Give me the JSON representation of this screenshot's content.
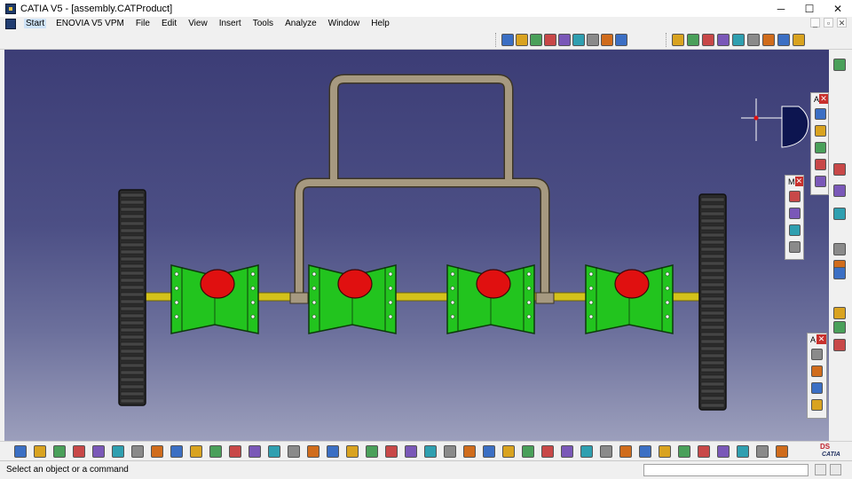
{
  "window": {
    "title": "CATIA V5 - [assembly.CATProduct]",
    "minimize_glyph": "─",
    "maximize_glyph": "☐",
    "close_glyph": "✕"
  },
  "menu": {
    "items": [
      "Start",
      "ENOVIA V5 VPM",
      "File",
      "Edit",
      "View",
      "Insert",
      "Tools",
      "Analyze",
      "Window",
      "Help"
    ],
    "doc_controls": [
      "_",
      "▫",
      "✕"
    ]
  },
  "palettes": {
    "analysis": {
      "title": "A",
      "close": "✕"
    },
    "measure": {
      "title": "M",
      "close": "✕"
    },
    "apply": {
      "title": "A",
      "close": "✕"
    }
  },
  "status": {
    "message": "Select an object or a command"
  },
  "brand": {
    "logo_text": "CATIA",
    "ds_text": "DS"
  },
  "colors": {
    "viewport_top": "#3c3d76",
    "roller_green": "#22c41e",
    "wheel_dark": "#2b2b2b",
    "axle_yellow": "#d4c21a",
    "frame_tan": "#a69980",
    "marker_red": "#e01010"
  },
  "toolbars": {
    "top_icons": [
      "fly-mode-icon",
      "select-icon",
      "analysis-icon",
      "visualization-icon",
      "measure-icon",
      "graph-icon",
      "sketch-icon",
      "rotate-icon",
      "grid-icon",
      "product-icon",
      "structure-icon",
      "component-icon",
      "insert-icon",
      "replace-icon",
      "reorder-icon",
      "catalog-icon",
      "update-icon",
      "publish-icon"
    ],
    "bottom_icons": [
      "grid-icon",
      "new-icon",
      "open-icon",
      "save-icon",
      "print-icon",
      "cut-icon",
      "copy-icon",
      "paste-icon",
      "undo-icon",
      "redo-icon",
      "whatsthis-icon",
      "formula-icon",
      "comment-icon",
      "table-icon",
      "graph-icon",
      "macro-icon",
      "render-icon",
      "fly-icon",
      "fit-all-icon",
      "pan-icon",
      "rotate-icon",
      "zoom-in-icon",
      "zoom-out-icon",
      "normal-view-icon",
      "iso-view-icon",
      "quick-view-icon",
      "multi-view-icon",
      "shading-icon",
      "hide-show-icon",
      "swap-icon",
      "constraint-icon",
      "snap-icon",
      "explode-icon",
      "clash-icon",
      "section-icon",
      "distance-icon",
      "generate-icon",
      "catalog-icon",
      "product-icon",
      "sim-icon"
    ]
  }
}
